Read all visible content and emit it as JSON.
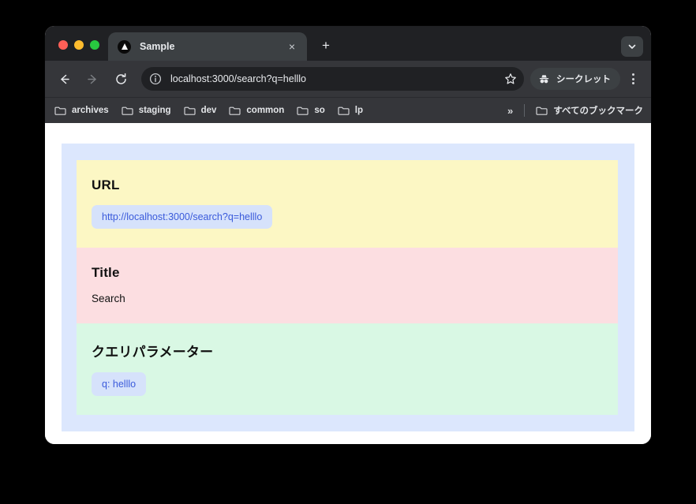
{
  "browser": {
    "tab": {
      "title": "Sample",
      "favicon": "triangle-favicon",
      "close_label": "×"
    },
    "new_tab_label": "+",
    "tabstrip_right_icon": "chevron-down-icon",
    "toolbar": {
      "back_icon": "back-arrow-icon",
      "forward_icon": "forward-arrow-icon",
      "reload_icon": "reload-icon",
      "site_info_icon": "info-circle-icon",
      "url": "localhost:3000/search?q=helllo",
      "bookmark_icon": "star-icon",
      "incognito_label": "シークレット",
      "incognito_icon": "incognito-icon",
      "menu_icon": "three-dot-menu-icon"
    },
    "bookmarks": {
      "items": [
        {
          "label": "archives",
          "icon": "folder-icon"
        },
        {
          "label": "staging",
          "icon": "folder-icon"
        },
        {
          "label": "dev",
          "icon": "folder-icon"
        },
        {
          "label": "common",
          "icon": "folder-icon"
        },
        {
          "label": "so",
          "icon": "folder-icon"
        },
        {
          "label": "lp",
          "icon": "folder-icon"
        }
      ],
      "overflow_label": "»",
      "all_bookmarks_label": "すべてのブックマーク",
      "all_bookmarks_icon": "folder-icon"
    }
  },
  "content": {
    "url_section": {
      "heading": "URL",
      "value": "http://localhost:3000/search?q=helllo"
    },
    "title_section": {
      "heading": "Title",
      "value": "Search"
    },
    "query_section": {
      "heading": "クエリパラメーター",
      "params": [
        {
          "label": "q: helllo"
        }
      ]
    }
  },
  "colors": {
    "outer_card": "#dce7fd",
    "url_panel": "#fcf7c4",
    "title_panel": "#fcdee1",
    "query_panel": "#d9f8e4",
    "chip_bg": "#d6e2fb",
    "chip_text": "#3b5bdb",
    "tab_strip": "#202124",
    "toolbar": "#35363a",
    "page_background": "#000000"
  }
}
